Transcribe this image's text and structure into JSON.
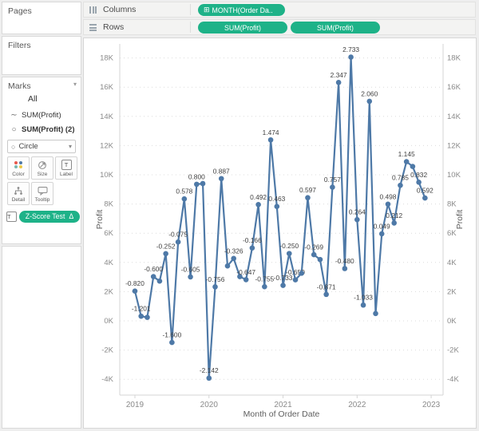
{
  "shelves": {
    "columns_label": "Columns",
    "rows_label": "Rows",
    "columns_pill": "MONTH(Order Da..",
    "columns_pill_icon": "expand-box-icon",
    "rows_pills": [
      "SUM(Profit)",
      "SUM(Profit)"
    ]
  },
  "sidebar": {
    "pages_title": "Pages",
    "filters_title": "Filters",
    "marks": {
      "title": "Marks",
      "all_label": "All",
      "items": [
        "SUM(Profit)",
        "SUM(Profit) (2)"
      ],
      "mark_type": "Circle",
      "buttons": [
        "Color",
        "Size",
        "Label",
        "Detail",
        "Tooltip"
      ],
      "zscore_label": "Z-Score Test",
      "zscore_delta": "Δ"
    }
  },
  "colors": {
    "pill_green": "#1eb288",
    "line_blue": "#4e79a7",
    "mark_label_text": "#414141",
    "axis_text": "#8a8a8a",
    "axis_title_text": "#5f5f5f",
    "gridline": "#dcdcdc",
    "axis_line": "#d4d4d4"
  },
  "chart_data": {
    "type": "line",
    "mark": "circle+line",
    "series_name": "SUM(Profit)",
    "xlabel": "Month of Order Date",
    "ylabel_left": "Profit",
    "ylabel_right": "Profit",
    "x_tick_years": [
      "2019",
      "2020",
      "2021",
      "2022",
      "2023"
    ],
    "y_tick_values_k": [
      -4,
      -2,
      0,
      2,
      4,
      6,
      8,
      10,
      12,
      14,
      16,
      18
    ],
    "points": [
      {
        "month": "2019-01",
        "profit": 2040,
        "z_label": "-0.820"
      },
      {
        "month": "2019-02",
        "profit": 320,
        "z_label": "-1.201"
      },
      {
        "month": "2019-03",
        "profit": 240,
        "z_label": null
      },
      {
        "month": "2019-04",
        "profit": 3030,
        "z_label": "-0.600"
      },
      {
        "month": "2019-05",
        "profit": 2720,
        "z_label": null
      },
      {
        "month": "2019-06",
        "profit": 4600,
        "z_label": "-0.252"
      },
      {
        "month": "2019-07",
        "profit": -1480,
        "z_label": "-1.600"
      },
      {
        "month": "2019-08",
        "profit": 5400,
        "z_label": "-0.075"
      },
      {
        "month": "2019-09",
        "profit": 8350,
        "z_label": "0.578"
      },
      {
        "month": "2019-10",
        "profit": 3010,
        "z_label": "-0.605"
      },
      {
        "month": "2019-11",
        "profit": 9350,
        "z_label": "0.800"
      },
      {
        "month": "2019-12",
        "profit": 9400,
        "z_label": null
      },
      {
        "month": "2020-01",
        "profit": -3920,
        "z_label": "-2.142"
      },
      {
        "month": "2020-02",
        "profit": 2330,
        "z_label": "-0.756"
      },
      {
        "month": "2020-03",
        "profit": 9740,
        "z_label": "0.887"
      },
      {
        "month": "2020-04",
        "profit": 3760,
        "z_label": null
      },
      {
        "month": "2020-05",
        "profit": 4270,
        "z_label": "-0.326"
      },
      {
        "month": "2020-06",
        "profit": 3030,
        "z_label": null
      },
      {
        "month": "2020-07",
        "profit": 2820,
        "z_label": "-0.647"
      },
      {
        "month": "2020-08",
        "profit": 4990,
        "z_label": "-0.166"
      },
      {
        "month": "2020-09",
        "profit": 7960,
        "z_label": "0.492"
      },
      {
        "month": "2020-10",
        "profit": 2340,
        "z_label": "-0.755"
      },
      {
        "month": "2020-11",
        "profit": 12390,
        "z_label": "1.474"
      },
      {
        "month": "2020-12",
        "profit": 7830,
        "z_label": "0.463"
      },
      {
        "month": "2021-01",
        "profit": 2430,
        "z_label": "-0.733"
      },
      {
        "month": "2021-02",
        "profit": 4610,
        "z_label": "-0.250"
      },
      {
        "month": "2021-03",
        "profit": 2810,
        "z_label": "-0.650"
      },
      {
        "month": "2021-04",
        "profit": 3260,
        "z_label": null
      },
      {
        "month": "2021-05",
        "profit": 8430,
        "z_label": "0.597"
      },
      {
        "month": "2021-06",
        "profit": 4530,
        "z_label": "-0.269"
      },
      {
        "month": "2021-07",
        "profit": 4200,
        "z_label": null
      },
      {
        "month": "2021-08",
        "profit": 1810,
        "z_label": "-0.871"
      },
      {
        "month": "2021-09",
        "profit": 9150,
        "z_label": "0.757"
      },
      {
        "month": "2021-10",
        "profit": 16320,
        "z_label": "2.347"
      },
      {
        "month": "2021-11",
        "profit": 3580,
        "z_label": "-0.480"
      },
      {
        "month": "2021-12",
        "profit": 18060,
        "z_label": "2.733"
      },
      {
        "month": "2022-01",
        "profit": 6930,
        "z_label": "0.264"
      },
      {
        "month": "2022-02",
        "profit": 1080,
        "z_label": "-1.033"
      },
      {
        "month": "2022-03",
        "profit": 15030,
        "z_label": "2.060"
      },
      {
        "month": "2022-04",
        "profit": 500,
        "z_label": null
      },
      {
        "month": "2022-05",
        "profit": 5960,
        "z_label": "0.049"
      },
      {
        "month": "2022-06",
        "profit": 7990,
        "z_label": "0.498"
      },
      {
        "month": "2022-07",
        "profit": 6700,
        "z_label": "0.212"
      },
      {
        "month": "2022-08",
        "profit": 9280,
        "z_label": "0.785"
      },
      {
        "month": "2022-09",
        "profit": 10900,
        "z_label": "1.145"
      },
      {
        "month": "2022-10",
        "profit": 10570,
        "z_label": null
      },
      {
        "month": "2022-11",
        "profit": 9490,
        "z_label": "0.832"
      },
      {
        "month": "2022-12",
        "profit": 8410,
        "z_label": "0.592"
      }
    ]
  }
}
